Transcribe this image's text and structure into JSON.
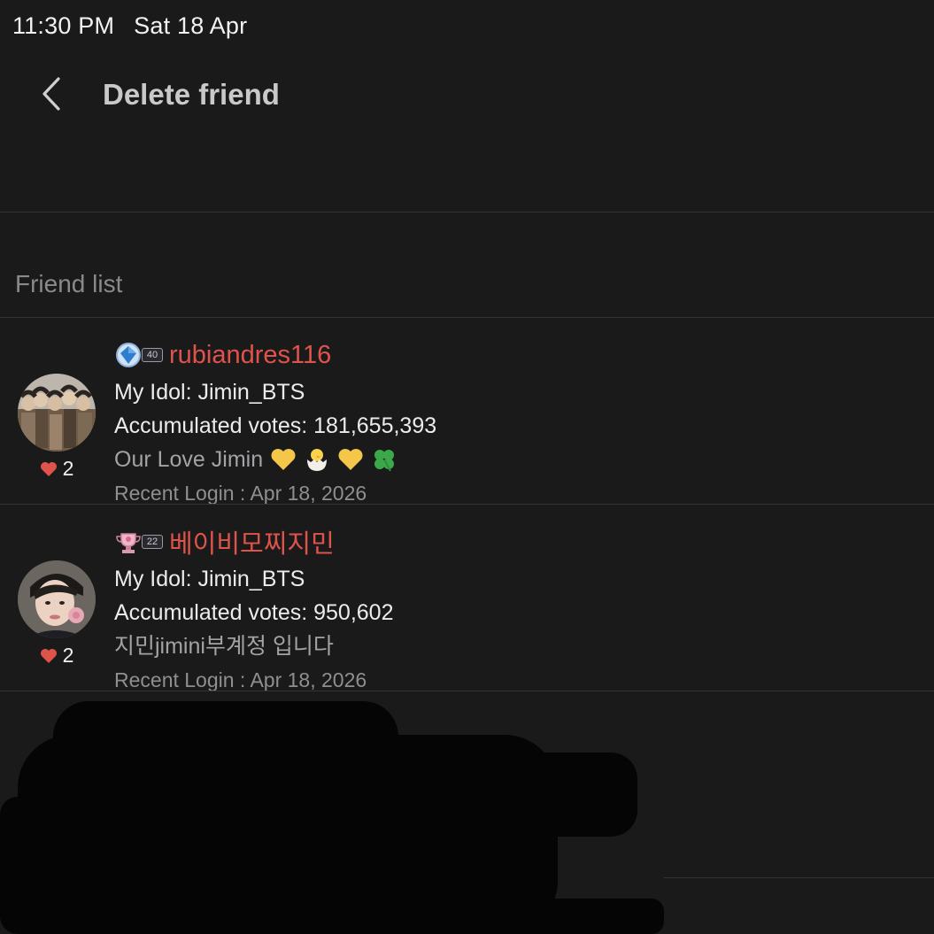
{
  "status_bar": {
    "time": "11:30 PM",
    "date": "Sat 18 Apr"
  },
  "header": {
    "title": "Delete friend",
    "back_icon": "chevron-left-icon"
  },
  "section": {
    "label": "Friend list"
  },
  "friends": [
    {
      "name": "rubiandres116",
      "level": "40",
      "idol": "My Idol: Jimin_BTS",
      "votes": "Accumulated votes: 181,655,393",
      "status": "Our Love Jimin",
      "status_emojis": [
        "yellow-heart",
        "hatching-chick",
        "yellow-heart",
        "four-leaf-clover"
      ],
      "recent_login": "Recent Login : Apr 18, 2026",
      "likes": "2"
    },
    {
      "name": "베이비모찌지민",
      "level": "22",
      "idol": "My Idol: Jimin_BTS",
      "votes": "Accumulated votes: 950,602",
      "status": "지민jimini부계정 입니다",
      "recent_login": "Recent Login : Apr 18, 2026",
      "likes": "2"
    }
  ],
  "colors": {
    "name_accent": "#e0534a",
    "heart": "#e0534a",
    "background": "#1a1a1b"
  }
}
